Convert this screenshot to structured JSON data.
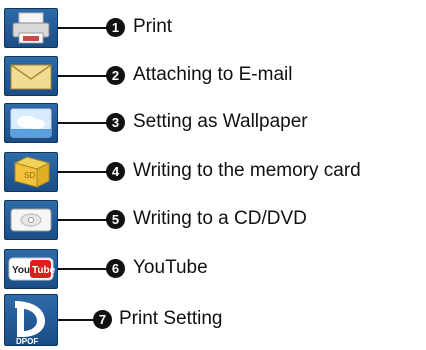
{
  "items": [
    {
      "number": "1",
      "label": "Print",
      "icon": "printer-icon"
    },
    {
      "number": "2",
      "label": "Attaching to E-mail",
      "icon": "envelope-icon"
    },
    {
      "number": "3",
      "label": "Setting as Wallpaper",
      "icon": "wallpaper-icon"
    },
    {
      "number": "4",
      "label": "Writing to the memory card",
      "icon": "memory-card-icon"
    },
    {
      "number": "5",
      "label": "Writing to a CD/DVD",
      "icon": "disc-icon"
    },
    {
      "number": "6",
      "label": "YouTube",
      "icon": "youtube-icon"
    },
    {
      "number": "7",
      "label": "Print Setting",
      "icon": "dpof-icon",
      "icon_text": "DPOF"
    }
  ],
  "colors": {
    "icon_blue": "#1e5a9a",
    "youtube_red": "#e01d1d",
    "badge": "#111111"
  }
}
